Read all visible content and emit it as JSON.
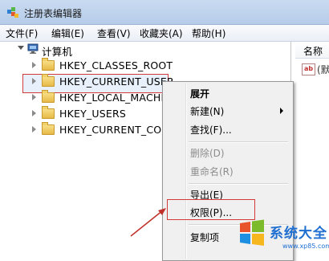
{
  "window": {
    "title": "注册表编辑器"
  },
  "menubar": {
    "items": [
      "文件(F)",
      "编辑(E)",
      "查看(V)",
      "收藏夹(A)",
      "帮助(H)"
    ]
  },
  "tree": {
    "root": "计算机",
    "nodes": [
      "HKEY_CLASSES_ROOT",
      "HKEY_CURRENT_USER",
      "HKEY_LOCAL_MACHIN",
      "HKEY_USERS",
      "HKEY_CURRENT_CONF"
    ],
    "selected": "HKEY_CURRENT_USER"
  },
  "right_pane": {
    "column_header": "名称",
    "value_name": "(默"
  },
  "context_menu": {
    "expand": "展开",
    "new": "新建(N)",
    "find": "查找(F)...",
    "delete": "删除(D)",
    "rename": "重命名(R)",
    "export": "导出(E)",
    "permissions": "权限(P)...",
    "copy_key": "复制项"
  },
  "watermark": {
    "brand": "系统大全",
    "url": "www.xp85.com"
  },
  "colors": {
    "highlight_border": "#d33a3a",
    "menu_background": "#f0f0f0",
    "title_bar": "#c9dbf1"
  }
}
